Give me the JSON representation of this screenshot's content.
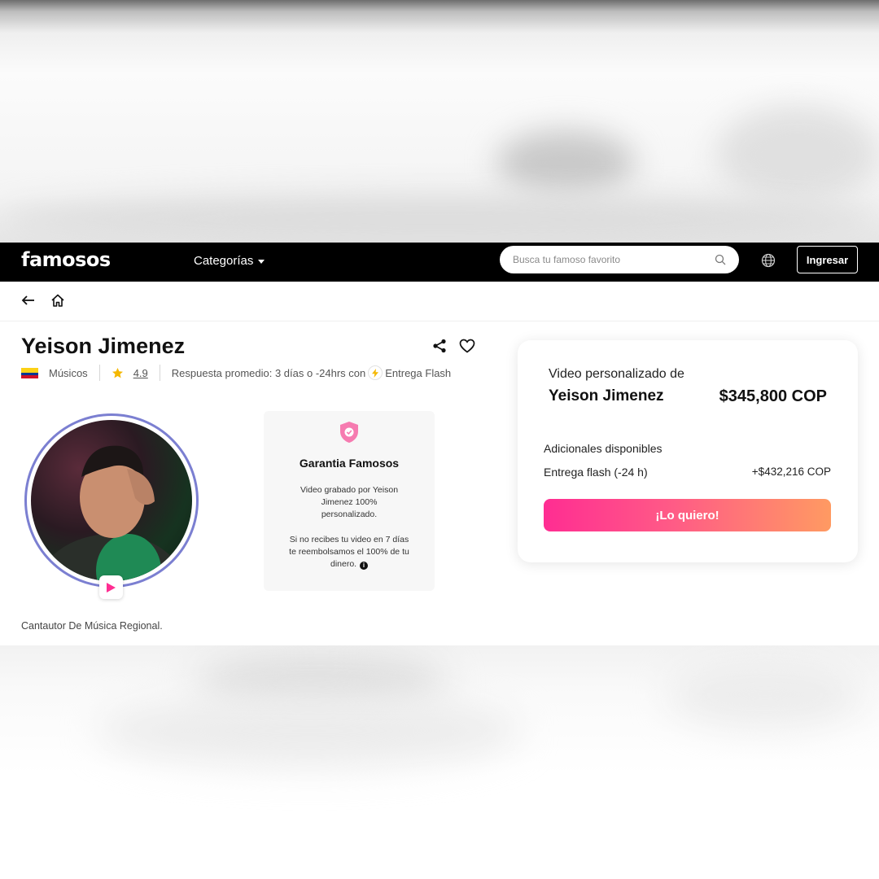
{
  "header": {
    "logo": "famosos",
    "categories_label": "Categorías",
    "search_placeholder": "Busca tu famoso favorito",
    "login_label": "Ingresar"
  },
  "profile": {
    "name": "Yeison Jimenez",
    "category": "Músicos",
    "rating": "4.9",
    "response_text": "Respuesta promedio: 3 días o -24hrs con",
    "flash_label": "Entrega Flash",
    "bio": "Cantautor De Música Regional."
  },
  "guarantee": {
    "title": "Garantia Famosos",
    "text1": "Video grabado por Yeison Jimenez 100% personalizado.",
    "text2": "Si no recibes tu video en 7 días te reembolsamos el 100% de tu dinero."
  },
  "card": {
    "label": "Video personalizado de",
    "name": "Yeison Jimenez",
    "price": "$345,800 COP",
    "addons_title": "Adicionales disponibles",
    "addon_name": "Entrega flash (-24 h)",
    "addon_price": "+$432,216 COP",
    "cta_label": "¡Lo quiero!"
  },
  "colors": {
    "accent_pink": "#ff2d92",
    "accent_orange": "#ff9a62",
    "avatar_ring": "#7b7fd1",
    "star": "#f5b800",
    "header_bg": "#000000"
  },
  "icons": [
    "search-icon",
    "globe-icon",
    "back-arrow-icon",
    "home-icon",
    "share-icon",
    "heart-icon",
    "star-icon",
    "flash-icon",
    "play-icon",
    "shield-check-icon",
    "info-icon",
    "colombia-flag-icon"
  ]
}
